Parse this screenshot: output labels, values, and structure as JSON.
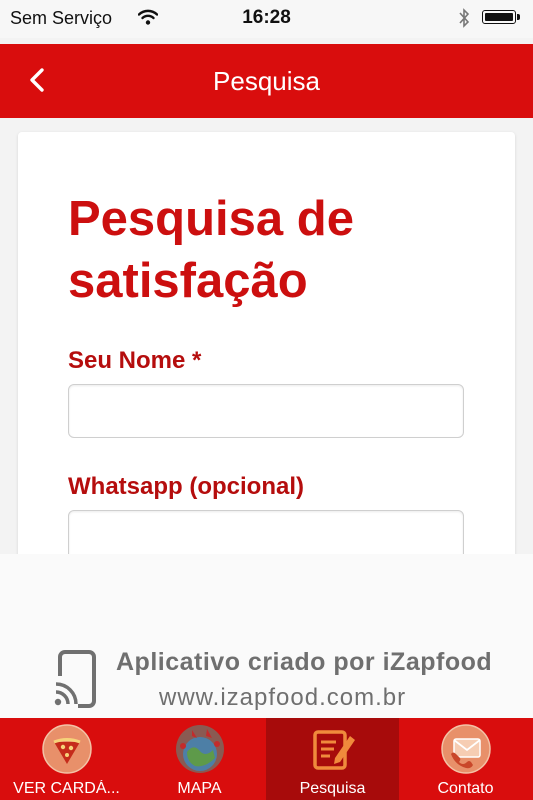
{
  "status_bar": {
    "carrier": "Sem Serviço",
    "time": "16:28"
  },
  "header": {
    "title": "Pesquisa",
    "back_icon": "chevron-left-icon"
  },
  "form": {
    "title": "Pesquisa de satisfação",
    "fields": [
      {
        "label": "Seu Nome *",
        "value": ""
      },
      {
        "label": "Whatsapp (opcional)",
        "value": ""
      }
    ]
  },
  "promo": {
    "line1": "Aplicativo criado por iZapfood",
    "line2": "www.izapfood.com.br"
  },
  "bottom_nav": {
    "items": [
      {
        "label": "VER CARDÁ...",
        "icon": "pizza-icon"
      },
      {
        "label": "MAPA",
        "icon": "globe-icon"
      },
      {
        "label": "Pesquisa",
        "icon": "survey-edit-icon",
        "active": true
      },
      {
        "label": "Contato",
        "icon": "mail-phone-icon"
      }
    ]
  },
  "colors": {
    "brand_red": "#d90d0d",
    "active_tab": "#a70b0b",
    "title_red": "#cc0f0f"
  }
}
